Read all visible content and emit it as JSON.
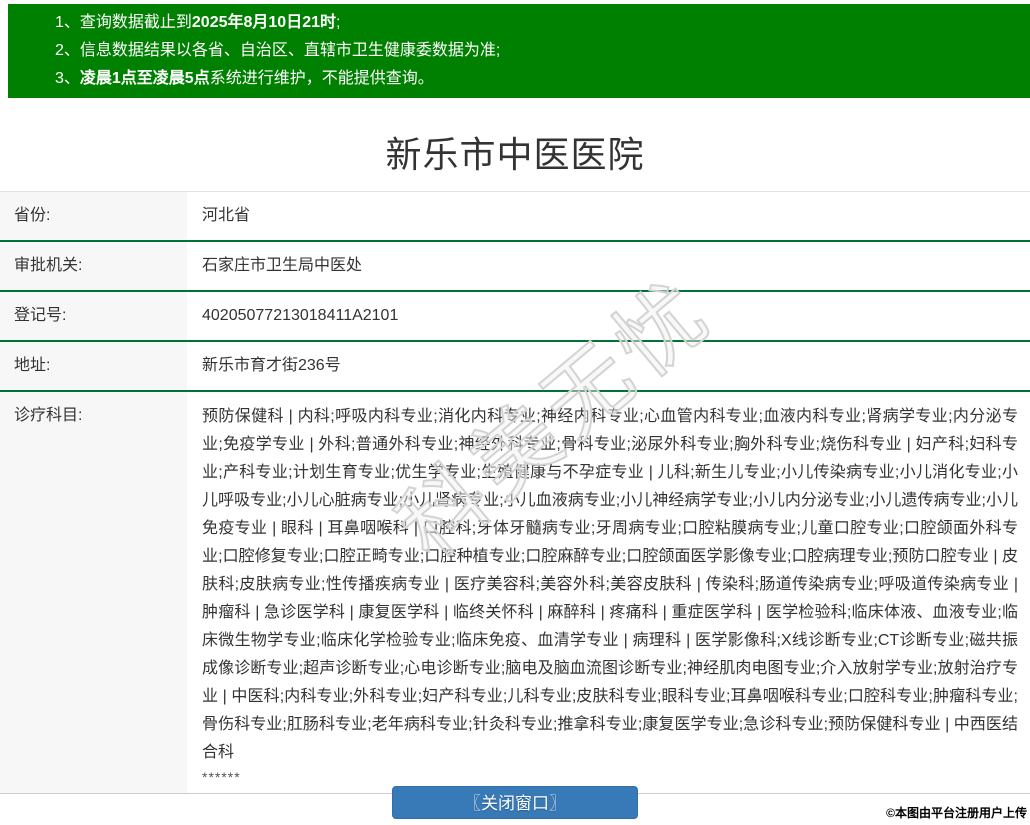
{
  "notices": {
    "items": [
      {
        "pre": "1、查询数据截止到",
        "bold": "2025年8月10日21时",
        "post": ";"
      },
      {
        "pre": "2、信息数据结果以各省、自治区、直辖市卫生健康委数据为准;",
        "bold": "",
        "post": ""
      },
      {
        "pre": "3、",
        "bold": "凌晨1点至凌晨5点",
        "post": "系统进行维护，不能提供查询。"
      }
    ]
  },
  "page": {
    "title": "新乐市中医医院"
  },
  "info": {
    "rows": [
      {
        "label": "省份:",
        "value": "河北省"
      },
      {
        "label": "审批机关:",
        "value": "石家庄市卫生局中医处"
      },
      {
        "label": "登记号:",
        "value": "40205077213018411A2101"
      },
      {
        "label": "地址:",
        "value": "新乐市育才街236号"
      },
      {
        "label": "诊疗科目:",
        "value": "预防保健科 | 内科;呼吸内科专业;消化内科专业;神经内科专业;心血管内科专业;血液内科专业;肾病学专业;内分泌专业;免疫学专业 | 外科;普通外科专业;神经外科专业;骨科专业;泌尿外科专业;胸外科专业;烧伤科专业 | 妇产科;妇科专业;产科专业;计划生育专业;优生学专业;生殖健康与不孕症专业 | 儿科;新生儿专业;小儿传染病专业;小儿消化专业;小儿呼吸专业;小儿心脏病专业;小儿肾病专业;小儿血液病专业;小儿神经病学专业;小儿内分泌专业;小儿遗传病专业;小儿免疫专业 | 眼科 | 耳鼻咽喉科 | 口腔科;牙体牙髓病专业;牙周病专业;口腔粘膜病专业;儿童口腔专业;口腔颌面外科专业;口腔修复专业;口腔正畸专业;口腔种植专业;口腔麻醉专业;口腔颌面医学影像专业;口腔病理专业;预防口腔专业 | 皮肤科;皮肤病专业;性传播疾病专业 | 医疗美容科;美容外科;美容皮肤科 | 传染科;肠道传染病专业;呼吸道传染病专业 | 肿瘤科 | 急诊医学科 | 康复医学科 | 临终关怀科 | 麻醉科 | 疼痛科 | 重症医学科 | 医学检验科;临床体液、血液专业;临床微生物学专业;临床化学检验专业;临床免疫、血清学专业 | 病理科 | 医学影像科;X线诊断专业;CT诊断专业;磁共振成像诊断专业;超声诊断专业;心电诊断专业;脑电及脑血流图诊断专业;神经肌肉电图专业;介入放射学专业;放射治疗专业 | 中医科;内科专业;外科专业;妇产科专业;儿科专业;皮肤科专业;眼科专业;耳鼻咽喉科专业;口腔科专业;肿瘤科专业;骨伤科专业;肛肠科专业;老年病科专业;针灸科专业;推拿科专业;康复医学专业;急诊科专业;预防保健科专业 | 中西医结合科",
        "extra": "******"
      }
    ]
  },
  "watermark": {
    "text": "科美无忧"
  },
  "footer": {
    "close_button": "〖关闭窗口〗",
    "credit": "©本图由平台注册用户上传"
  },
  "colors": {
    "notice_bg": "#008000",
    "row_divider": "#007236",
    "label_bg": "#f7f7f7",
    "button_bg": "#3879b8",
    "text": "#333333"
  }
}
